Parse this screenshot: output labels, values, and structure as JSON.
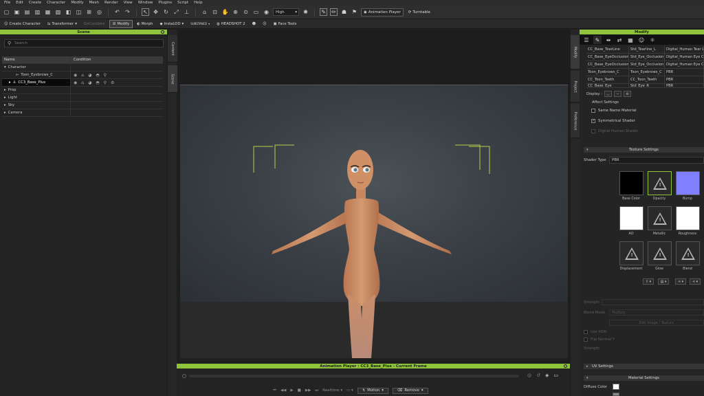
{
  "menu": [
    "File",
    "Edit",
    "Create",
    "Character",
    "Modify",
    "Mesh",
    "Render",
    "View",
    "Window",
    "Plugins",
    "Script",
    "Help"
  ],
  "toolbar1": {
    "quality": "High",
    "animation_player_label": "Animation Player",
    "turntable_label": "Turntable"
  },
  "toolbar2": {
    "create_character": "Create Character",
    "transformer": "Transformer",
    "gocombine": "GoCombine",
    "modify": "Modify",
    "morph": "Morph",
    "instalod": "InstaLOD",
    "substance": "SUBSTANCE",
    "headshot": "HEADSHOT 2",
    "face_tools": "Face Tools"
  },
  "scene": {
    "title": "Scene",
    "search_placeholder": "Search",
    "columns": [
      "Name",
      "Condition"
    ],
    "rows": [
      {
        "name": "Character",
        "level": 0,
        "expanded": true
      },
      {
        "name": "Toon_Eyebrows_C",
        "level": 2
      },
      {
        "name": "CC3_Base_Plus",
        "level": 1,
        "selected": true
      },
      {
        "name": "Prop",
        "level": 0
      },
      {
        "name": "Light",
        "level": 0
      },
      {
        "name": "Sky",
        "level": 0
      },
      {
        "name": "Camera",
        "level": 0
      }
    ],
    "side_tabs": [
      "Content",
      "Scene"
    ]
  },
  "anim_player": {
    "title": "Animation Player : CC3_Base_Plus - Current Frame",
    "realtime": "Realtime",
    "motion": "Motion",
    "remove": "Remove"
  },
  "right_tabs": [
    "Modify",
    "Project",
    "Preference"
  ],
  "modify": {
    "title": "Modify",
    "materials": [
      [
        "CC_Base_TearLine",
        "Std_Tearline_L",
        "Digital_Human Tear Line"
      ],
      [
        "CC_Base_EyeOcclusion",
        "Std_Eye_Occlusion_R",
        "Digital_Human Eye Occlusion"
      ],
      [
        "CC_Base_EyeOcclusion",
        "Std_Eye_Occlusion_L",
        "Digital_Human Eye Occlusion"
      ],
      [
        "Toon_Eyebrows_C",
        "Toon_Eyebrows_C",
        "PBR"
      ],
      [
        "CC_Toon_Teeth",
        "CC_Toon_Teeth",
        "PBR"
      ],
      [
        "CC_Base_Eye",
        "Std_Eye_R",
        "PBR"
      ]
    ],
    "display_label": "Display :",
    "affect_settings": "Affect Settings",
    "same_name_material": "Same Name Material",
    "symmetrical_shader": "Symmetrical Shader",
    "digital_human_shader": "Digital Human Shader",
    "texture_settings": "Texture Settings",
    "shader_type_label": "Shader Type",
    "shader_type_value": "PBR",
    "textures": [
      {
        "name": "Base Color",
        "kind": "black"
      },
      {
        "name": "Opacity",
        "kind": "warn",
        "selected": true
      },
      {
        "name": "Bump",
        "kind": "blue"
      },
      {
        "name": "AO",
        "kind": "white"
      },
      {
        "name": "Metallic",
        "kind": "warn"
      },
      {
        "name": "Roughness",
        "kind": "white"
      },
      {
        "name": "Displacement",
        "kind": "warn"
      },
      {
        "name": "Glow",
        "kind": "warn"
      },
      {
        "name": "Blend",
        "kind": "warn"
      }
    ],
    "dim_fields": {
      "strength": "Strength",
      "blend_mode": "Blend Mode",
      "blend_mode_value": "Multiply",
      "edit_image": "Edit Image / Texture",
      "use_hdr": "Use HDR",
      "flip_normal": "Flip Normal Y",
      "strength2": "Strength"
    },
    "uv_settings": "UV Settings",
    "material_settings": "Material Settings",
    "diffuse_color": "Diffuse Color"
  },
  "colors": {
    "accent_green": "#8fc43a",
    "bump_blue": "#8080ff"
  }
}
